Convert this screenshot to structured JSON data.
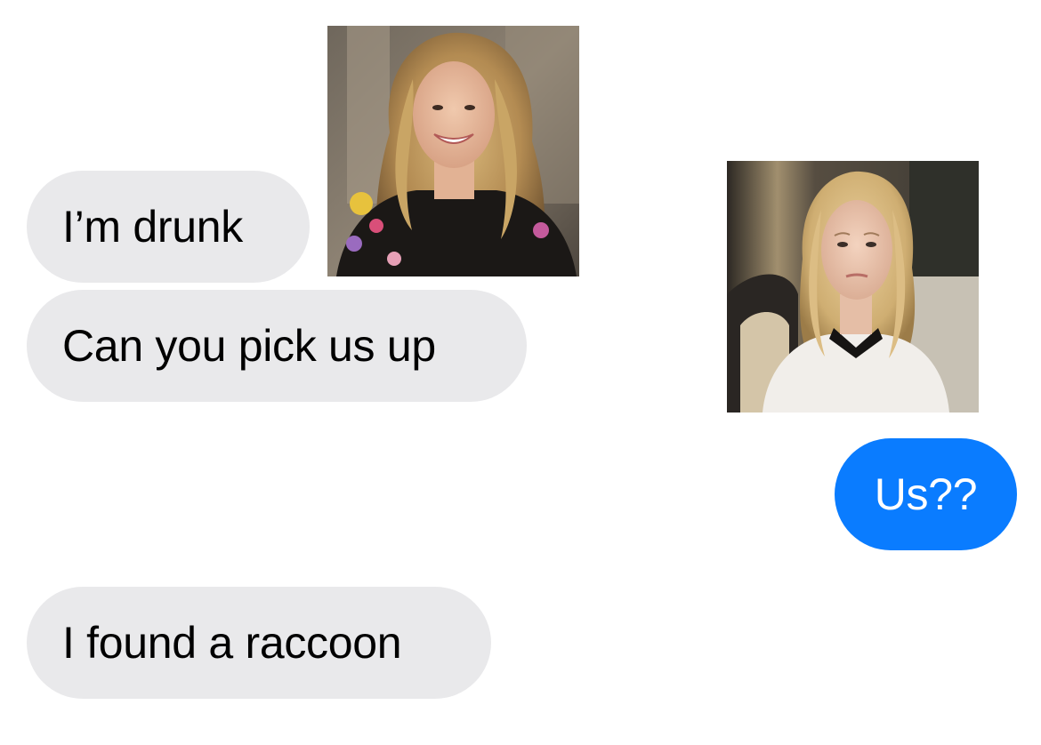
{
  "conversation": {
    "messages": [
      {
        "sender": "other",
        "text": "I’m drunk"
      },
      {
        "sender": "other",
        "text": "Can you pick us up"
      },
      {
        "sender": "me",
        "text": "Us??"
      },
      {
        "sender": "other",
        "text": "I found a raccoon"
      }
    ],
    "reaction_images": [
      {
        "icon": "woman-smiling-curly-blonde-hair-photo"
      },
      {
        "icon": "woman-worried-blonde-hair-photo"
      }
    ]
  },
  "colors": {
    "received_bubble": "#e9e9eb",
    "sent_bubble": "#0a7cff",
    "received_text": "#000000",
    "sent_text": "#ffffff"
  }
}
